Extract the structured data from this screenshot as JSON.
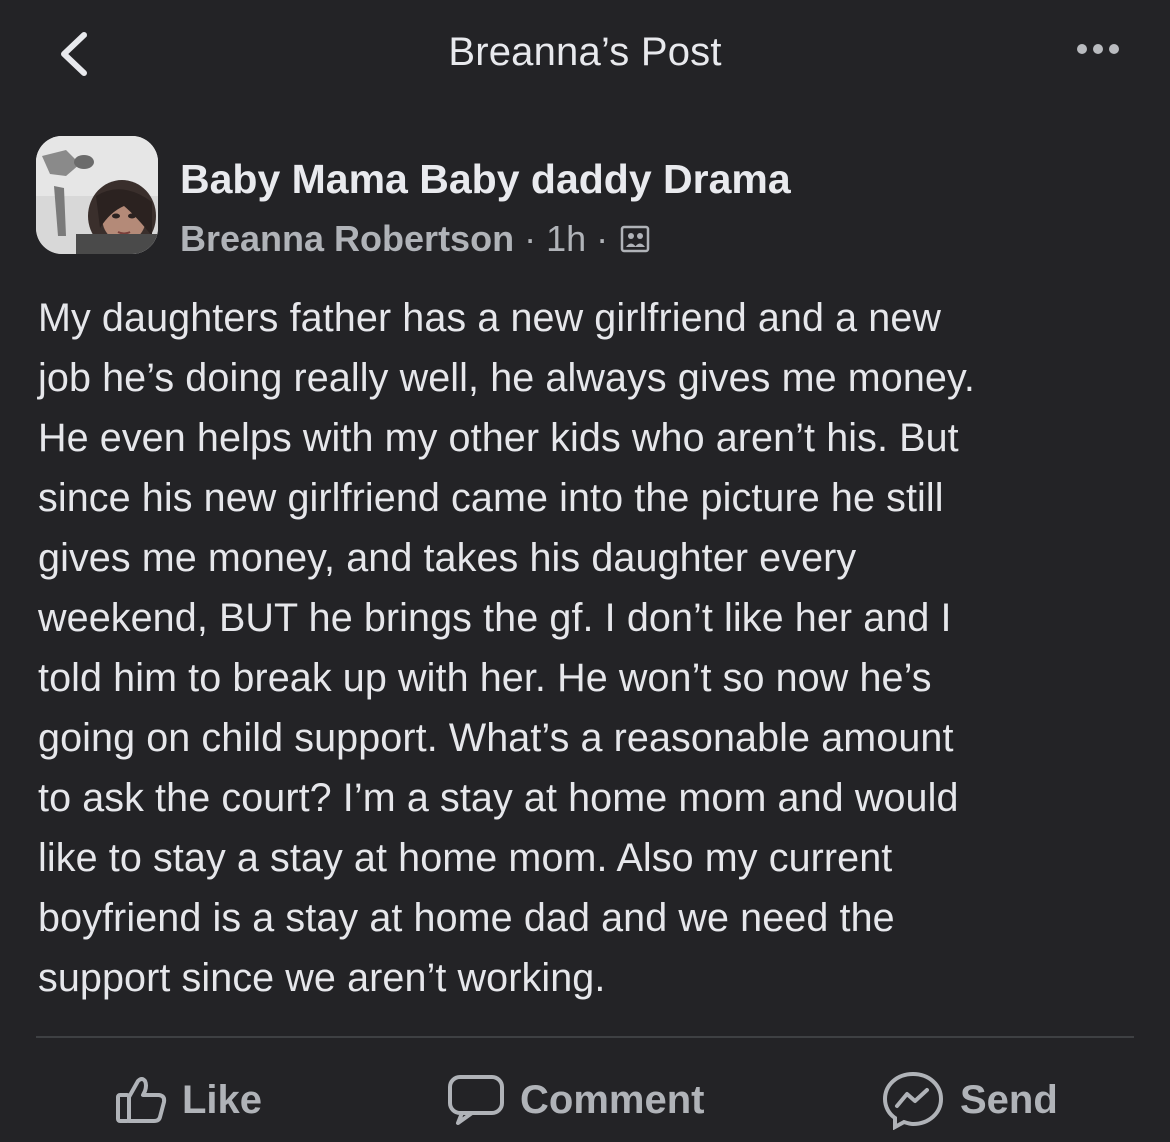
{
  "header": {
    "title": "Breanna’s Post",
    "back_icon": "chevron-left-icon",
    "more_icon": "more-horizontal-icon"
  },
  "post": {
    "group_name": "Baby Mama Baby daddy Drama",
    "author": "Breanna Robertson",
    "separator": "·",
    "time": "1h",
    "audience_icon": "group-icon",
    "body": "My daughters father has a new girlfriend and a new\njob he’s doing really well, he always gives me money.\nHe even helps with my other kids who aren’t his. But\nsince his new girlfriend came into the picture he still\ngives me money, and takes his daughter every\nweekend, BUT he brings the gf. I don’t like her and I\ntold him to break up with her. He won’t so now he’s\ngoing on child support. What’s a reasonable amount\nto ask the court? I’m a stay at home mom and would\nlike to stay a stay at home mom. Also my current\nboyfriend is a stay at home dad and we need the\nsupport since we aren’t working."
  },
  "actions": {
    "like_label": "Like",
    "comment_label": "Comment",
    "send_label": "Send"
  },
  "colors": {
    "background": "#232326",
    "text_primary": "#e4e6eb",
    "text_secondary": "#b0b3b8",
    "divider": "#3e4043"
  }
}
